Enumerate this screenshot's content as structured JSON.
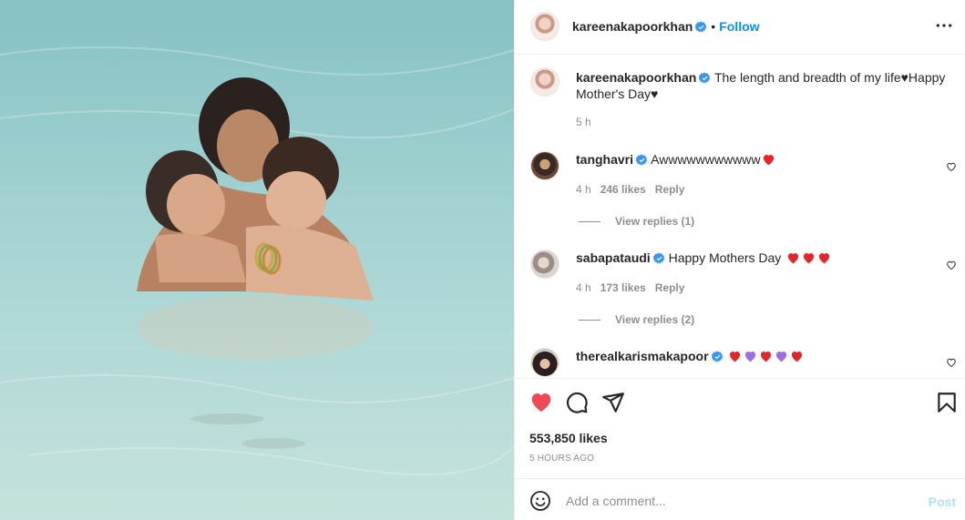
{
  "post": {
    "author": "kareenakapoorkhan",
    "follow_label": "Follow",
    "separator": "•"
  },
  "caption": {
    "username": "kareenakapoorkhan",
    "text": "The length and breadth of my life♥Happy Mother's Day♥",
    "time": "5 h"
  },
  "comments": [
    {
      "username": "tanghavri",
      "text": "Awwwwwwwwwww",
      "emoji": [
        "red-heart"
      ],
      "time": "4 h",
      "likes": "246 likes",
      "reply": "Reply",
      "view_replies": "View replies (1)"
    },
    {
      "username": "sabapataudi",
      "text": "Happy Mothers Day",
      "emoji": [
        "red-heart",
        "red-heart",
        "red-heart"
      ],
      "time": "4 h",
      "likes": "173 likes",
      "reply": "Reply",
      "view_replies": "View replies (2)"
    },
    {
      "username": "therealkarismakapoor",
      "text": "",
      "emoji": [
        "red-heart",
        "purple-heart",
        "red-heart",
        "purple-heart",
        "red-heart"
      ]
    }
  ],
  "stats": {
    "likes": "553,850 likes",
    "posted_ago": "5 HOURS AGO"
  },
  "add_comment": {
    "placeholder": "Add a comment...",
    "post_label": "Post"
  },
  "icons": {
    "like": "heart-filled-icon",
    "comment": "comment-icon",
    "share": "paper-plane-icon",
    "save": "bookmark-icon",
    "more": "more-options-icon",
    "emoji": "smiley-icon"
  },
  "colors": {
    "like_red": "#ed4956",
    "link_blue": "#0095f6",
    "post_disabled": "#b2dffc",
    "verified_blue": "#3897f0",
    "purple_heart": "#9d6fe0"
  }
}
